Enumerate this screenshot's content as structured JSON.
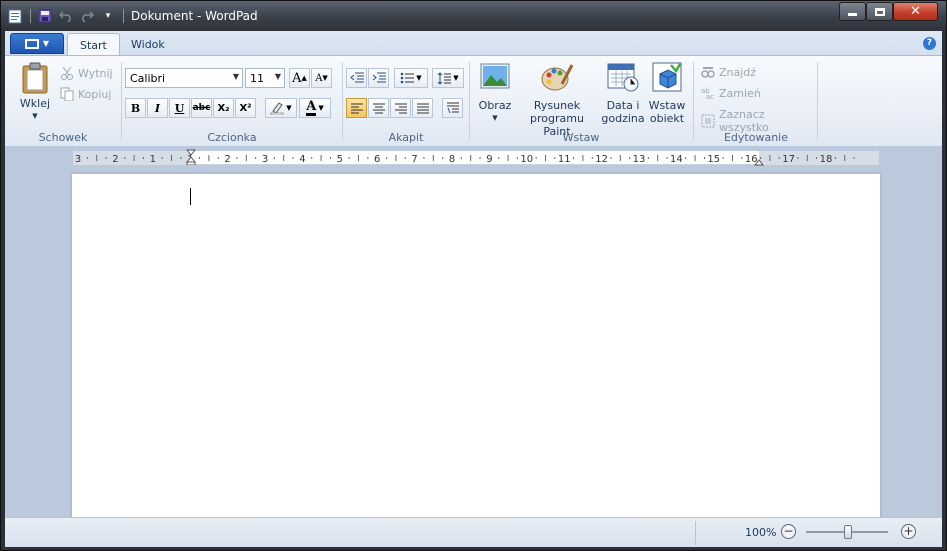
{
  "window": {
    "title": "Dokument - WordPad"
  },
  "quick_access": [
    "wordpad-app-icon",
    "save-icon",
    "undo-icon",
    "redo-icon",
    "customize-dropdown-icon"
  ],
  "tabs": {
    "start": "Start",
    "widok": "Widok"
  },
  "clipboard": {
    "paste": "Wklej",
    "cut": "Wytnij",
    "copy": "Kopiuj",
    "label": "Schowek"
  },
  "font": {
    "family": "Calibri",
    "size": "11",
    "label": "Czcionka",
    "bold": "B",
    "italic": "I",
    "underline": "U",
    "strike": "abc",
    "subscript": "X₂",
    "superscript": "X²",
    "grow": "A",
    "shrink": "A"
  },
  "paragraph": {
    "label": "Akapit"
  },
  "insert": {
    "picture": "Obraz",
    "paint1": "Rysunek",
    "paint2": "programu Paint",
    "date1": "Data i",
    "date2": "godzina",
    "object1": "Wstaw",
    "object2": "obiekt",
    "label": "Wstaw"
  },
  "editing": {
    "find": "Znajdź",
    "replace": "Zamień",
    "select_all": "Zaznacz wszystko",
    "label": "Edytowanie"
  },
  "ruler": {
    "ticks": [
      "3",
      "2",
      "1",
      "1",
      "2",
      "3",
      "4",
      "5",
      "6",
      "7",
      "8",
      "9",
      "10",
      "11",
      "12",
      "13",
      "14",
      "15",
      "16",
      "17",
      "18"
    ]
  },
  "status": {
    "zoom": "100%"
  },
  "colors": {
    "accent": "#1d56b0",
    "ribbon": "#e8eef7",
    "titlebar": "#3a4049",
    "canvas": "#bcc9dc"
  }
}
